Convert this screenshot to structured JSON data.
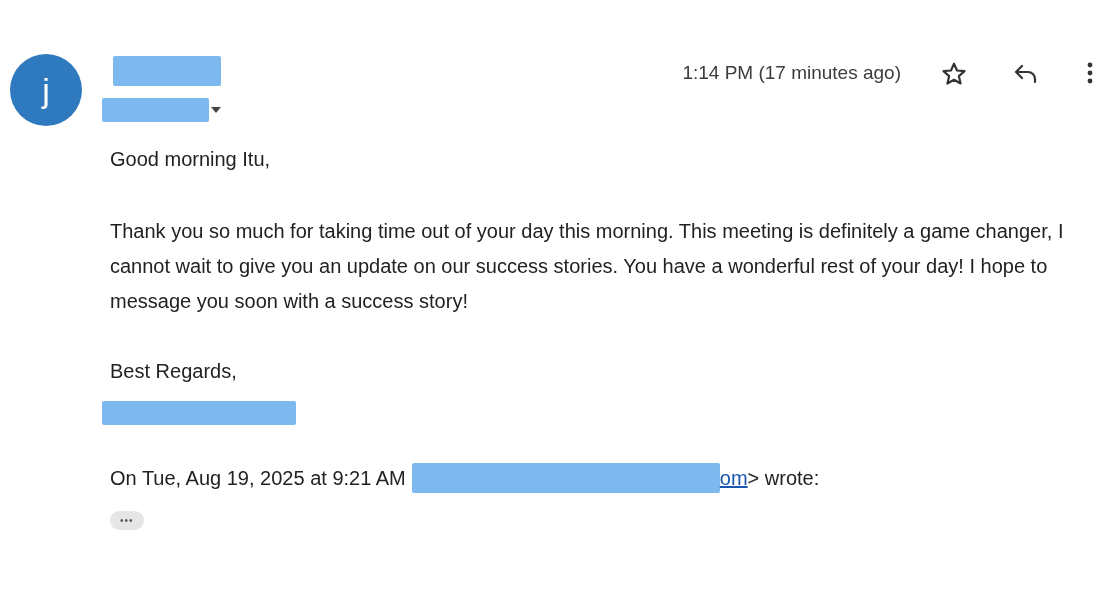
{
  "sender": {
    "avatar_letter": "j"
  },
  "header": {
    "time": "1:14 PM (17 minutes ago)",
    "starred": false
  },
  "body": {
    "greeting": "Good morning Itu,",
    "paragraph": "Thank you so much for taking time out of your day this morning. This meeting is definitely a game changer, I cannot wait to give you an update on our success stories. You have a wonderful rest of your day! I hope to message you soon with a success story!",
    "closing": "Best Regards,"
  },
  "quote_header": {
    "prefix": "On Tue, Aug 19, 2025 at 9:21 AM",
    "link": "om",
    "suffix": "> wrote:"
  },
  "trimmed_content": "•••"
}
